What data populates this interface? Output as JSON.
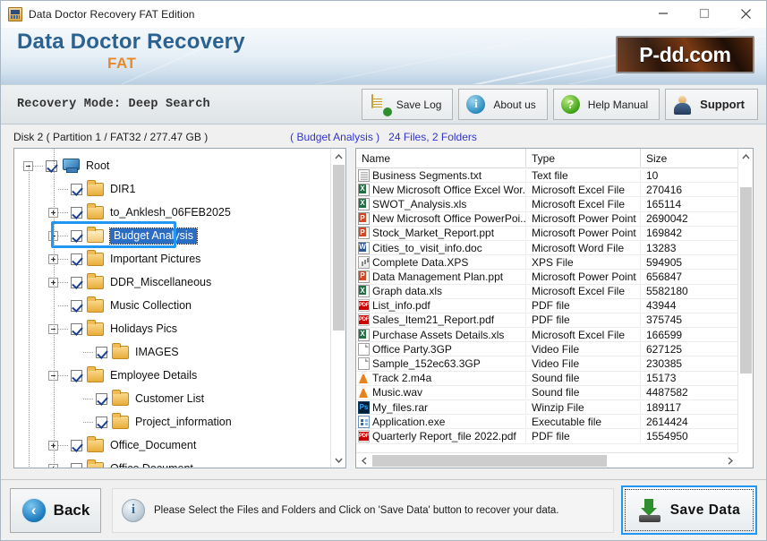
{
  "titlebar": {
    "app_icon": "app-icon",
    "title": "Data Doctor Recovery FAT Edition",
    "minimize": "minimize-icon",
    "maximize": "maximize-icon",
    "close": "close-icon"
  },
  "banner": {
    "brand_main": "Data Doctor Recovery",
    "brand_sub": "FAT",
    "logo_text": "P-dd.com"
  },
  "toolbar": {
    "recovery_mode": "Recovery Mode: Deep Search",
    "buttons": [
      {
        "label": "Save Log",
        "icon": "save-log-icon"
      },
      {
        "label": "About us",
        "icon": "info-icon"
      },
      {
        "label": "Help Manual",
        "icon": "question-mark-icon"
      },
      {
        "label": "Support",
        "icon": "support-person-icon"
      }
    ]
  },
  "content": {
    "disk_label": "Disk 2 ( Partition 1 / FAT32 / 277.47 GB )",
    "selected_folder": "( Budget Analysis )",
    "counts": "24 Files, 2 Folders"
  },
  "tree": {
    "nodes": [
      {
        "label": "Root",
        "depth": 0,
        "toggle": "minus",
        "icon": "computer-icon",
        "checked": true,
        "selected": false
      },
      {
        "label": "DIR1",
        "depth": 1,
        "toggle": "none",
        "icon": "folder-icon",
        "checked": true,
        "selected": false
      },
      {
        "label": "to_Anklesh_06FEB2025",
        "depth": 1,
        "toggle": "plus",
        "icon": "folder-icon",
        "checked": true,
        "selected": false
      },
      {
        "label": "Budget Analysis",
        "depth": 1,
        "toggle": "plus",
        "icon": "folder-open-icon",
        "checked": true,
        "selected": true
      },
      {
        "label": "Important Pictures",
        "depth": 1,
        "toggle": "plus",
        "icon": "folder-icon",
        "checked": true,
        "selected": false
      },
      {
        "label": "DDR_Miscellaneous",
        "depth": 1,
        "toggle": "plus",
        "icon": "folder-icon",
        "checked": true,
        "selected": false
      },
      {
        "label": "Music Collection",
        "depth": 1,
        "toggle": "none",
        "icon": "folder-icon",
        "checked": true,
        "selected": false
      },
      {
        "label": "Holidays Pics",
        "depth": 1,
        "toggle": "minus",
        "icon": "folder-icon",
        "checked": true,
        "selected": false
      },
      {
        "label": "IMAGES",
        "depth": 2,
        "toggle": "none",
        "icon": "folder-icon",
        "checked": true,
        "selected": false
      },
      {
        "label": "Employee Details",
        "depth": 1,
        "toggle": "minus",
        "icon": "folder-icon",
        "checked": true,
        "selected": false
      },
      {
        "label": "Customer List",
        "depth": 2,
        "toggle": "none",
        "icon": "folder-icon",
        "checked": true,
        "selected": false
      },
      {
        "label": "Project_information",
        "depth": 2,
        "toggle": "none",
        "icon": "folder-icon",
        "checked": true,
        "selected": false
      },
      {
        "label": "Office_Document",
        "depth": 1,
        "toggle": "plus",
        "icon": "folder-icon",
        "checked": true,
        "selected": false
      },
      {
        "label": "Office Document",
        "depth": 1,
        "toggle": "plus",
        "icon": "folder-icon",
        "checked": true,
        "selected": false
      }
    ]
  },
  "filelist": {
    "columns": [
      "Name",
      "Type",
      "Size"
    ],
    "rows": [
      {
        "name": "Business Segments.txt",
        "type": "Text file",
        "size": "10",
        "icon": "txt"
      },
      {
        "name": "New Microsoft Office Excel Wor...",
        "type": "Microsoft Excel File",
        "size": "270416",
        "icon": "xls"
      },
      {
        "name": "SWOT_Analysis.xls",
        "type": "Microsoft Excel File",
        "size": "165114",
        "icon": "xls"
      },
      {
        "name": "New Microsoft Office PowerPoi...",
        "type": "Microsoft Power Point File",
        "size": "2690042",
        "icon": "ppt"
      },
      {
        "name": "Stock_Market_Report.ppt",
        "type": "Microsoft Power Point File",
        "size": "169842",
        "icon": "ppt"
      },
      {
        "name": "Cities_to_visit_info.doc",
        "type": "Microsoft Word File",
        "size": "13283",
        "icon": "doc"
      },
      {
        "name": "Complete Data.XPS",
        "type": "XPS File",
        "size": "594905",
        "icon": "xps"
      },
      {
        "name": "Data Management Plan.ppt",
        "type": "Microsoft Power Point File",
        "size": "656847",
        "icon": "ppt"
      },
      {
        "name": "Graph data.xls",
        "type": "Microsoft Excel File",
        "size": "5582180",
        "icon": "xls"
      },
      {
        "name": "List_info.pdf",
        "type": "PDF file",
        "size": "43944",
        "icon": "pdf"
      },
      {
        "name": "Sales_Item21_Report.pdf",
        "type": "PDF file",
        "size": "375745",
        "icon": "pdf"
      },
      {
        "name": "Purchase Assets Details.xls",
        "type": "Microsoft Excel File",
        "size": "166599",
        "icon": "xls"
      },
      {
        "name": "Office Party.3GP",
        "type": "Video File",
        "size": "627125",
        "icon": "blank"
      },
      {
        "name": "Sample_152ec63.3GP",
        "type": "Video File",
        "size": "230385",
        "icon": "blank"
      },
      {
        "name": "Track 2.m4a",
        "type": "Sound file",
        "size": "15173",
        "icon": "vlc"
      },
      {
        "name": "Music.wav",
        "type": "Sound file",
        "size": "4487582",
        "icon": "vlc"
      },
      {
        "name": "My_files.rar",
        "type": "Winzip File",
        "size": "189117",
        "icon": "ps"
      },
      {
        "name": "Application.exe",
        "type": "Executable file",
        "size": "2614424",
        "icon": "exe"
      },
      {
        "name": "Quarterly Report_file 2022.pdf",
        "type": "PDF file",
        "size": "1554950",
        "icon": "pdf"
      }
    ]
  },
  "footer": {
    "back_label": "Back",
    "back_icon": "back-arrow-icon",
    "hint_icon": "info-icon",
    "hint_text": "Please Select the Files and Folders and Click on 'Save Data' button to recover your data.",
    "save_label": "Save  Data",
    "save_icon": "save-download-icon"
  },
  "colors": {
    "brand_blue": "#2b6291",
    "brand_orange": "#e8882a",
    "selection_blue": "#2b6cc4",
    "focus_blue": "#2196f3",
    "info_text": "#3333cc"
  }
}
